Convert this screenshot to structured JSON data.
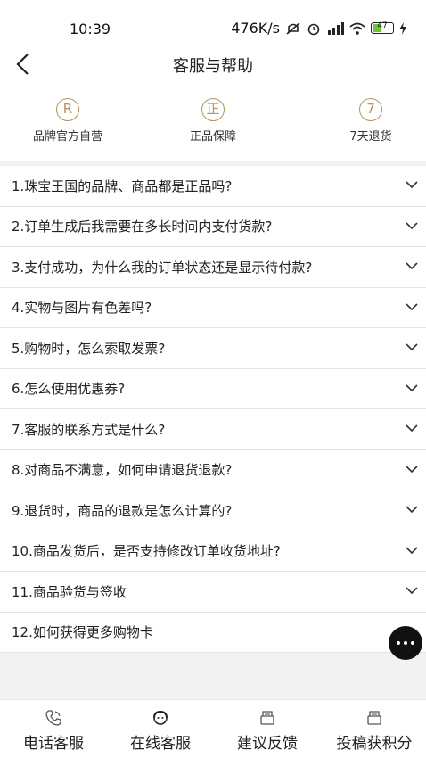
{
  "status_bar": {
    "time": "10:39",
    "network_speed": "476K/s",
    "battery_level": "47",
    "battery_fraction": 0.47
  },
  "header": {
    "title": "客服与帮助"
  },
  "badges": [
    {
      "icon": "registered-icon",
      "glyph": "R",
      "label": "品牌官方自营"
    },
    {
      "icon": "genuine-icon",
      "glyph": "正",
      "label": "正品保障"
    },
    {
      "icon": "seven-day-icon",
      "glyph": "7",
      "label": "7天退货"
    }
  ],
  "faq": [
    "1.珠宝王国的品牌、商品都是正品吗?",
    "2.订单生成后我需要在多长时间内支付货款?",
    "3.支付成功，为什么我的订单状态还是显示待付款?",
    "4.实物与图片有色差吗?",
    "5.购物时，怎么索取发票?",
    "6.怎么使用优惠券?",
    "7.客服的联系方式是什么?",
    "8.对商品不满意，如何申请退货退款?",
    "9.退货时，商品的退款是怎么计算的?",
    "10.商品发货后，是否支持修改订单收货地址?",
    "11.商品验货与签收",
    "12.如何获得更多购物卡"
  ],
  "tabs": [
    {
      "icon": "phone-icon",
      "label": "电话客服"
    },
    {
      "icon": "agent-icon",
      "label": "在线客服"
    },
    {
      "icon": "feedback-icon",
      "label": "建议反馈"
    },
    {
      "icon": "submission-icon",
      "label": "投稿获积分"
    }
  ],
  "colors": {
    "accent_gold": "#b8925a",
    "fab": "#111111",
    "battery_green": "#6fc53a"
  }
}
